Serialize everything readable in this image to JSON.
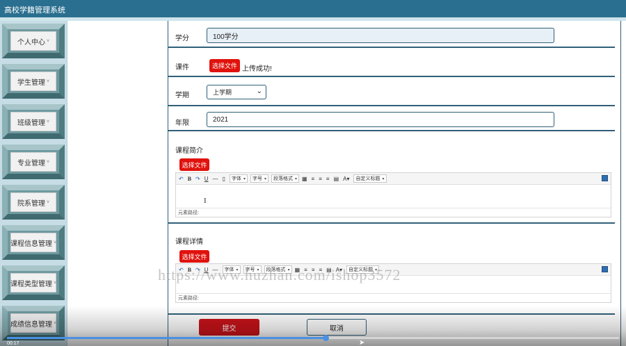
{
  "app": {
    "title": "高校学籍管理系统"
  },
  "sidebar": {
    "items": [
      {
        "label": "个人中心"
      },
      {
        "label": "学生管理"
      },
      {
        "label": "班级管理"
      },
      {
        "label": "专业管理"
      },
      {
        "label": "院系管理"
      },
      {
        "label": "课程信息管理"
      },
      {
        "label": "课程类型管理"
      },
      {
        "label": "成绩信息管理"
      }
    ],
    "caret": "˅"
  },
  "form": {
    "credit": {
      "label": "学分",
      "value": "100学分"
    },
    "courseware": {
      "label": "课件",
      "button": "选择文件",
      "status": "上传成功!"
    },
    "semester": {
      "label": "学期",
      "selected": "上学期"
    },
    "year": {
      "label": "年限",
      "value": "2021"
    },
    "intro": {
      "label": "课程简介",
      "button": "选择文件"
    },
    "detail": {
      "label": "课程详情",
      "button": "选择文件"
    },
    "submit_label": "提交",
    "cancel_label": "取消"
  },
  "editor": {
    "font_family": "字体",
    "font_size": "字号",
    "paragraph": "段落格式",
    "custom_title": "自定义标题",
    "element_path": "元素路径:"
  },
  "overlay": {
    "watermark": "https://www.huzhan.com/ishop3572",
    "time": "00:17",
    "progress": 0.52
  },
  "colors": {
    "topbar": "#2a6f8f",
    "accent_line": "#2f5f78",
    "button_red": "#e0120d",
    "submit_red": "#c8131a",
    "sidebar_bg": "#c6dde6"
  }
}
